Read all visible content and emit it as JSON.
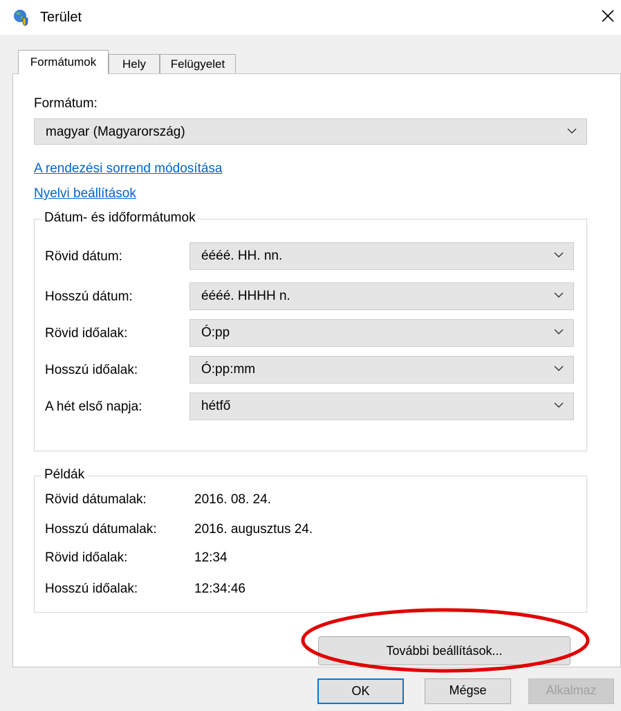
{
  "window": {
    "title": "Terület",
    "icon": "globe-shield-icon",
    "close_icon": "close-icon"
  },
  "tabs": [
    {
      "label": "Formátumok",
      "active": true
    },
    {
      "label": "Hely",
      "active": false
    },
    {
      "label": "Felügyelet",
      "active": false
    }
  ],
  "format": {
    "label": "Formátum:",
    "value": "magyar (Magyarország)"
  },
  "links": {
    "sort_order": "A rendezési sorrend módosítása",
    "language_settings": "Nyelvi beállítások"
  },
  "date_time": {
    "legend": "Dátum- és időformátumok",
    "rows": [
      {
        "label": "Rövid dátum:",
        "value": "éééé. HH. nn."
      },
      {
        "label": "Hosszú dátum:",
        "value": "éééé. HHHH n."
      },
      {
        "label": "Rövid időalak:",
        "value": "Ó:pp"
      },
      {
        "label": "Hosszú időalak:",
        "value": "Ó:pp:mm"
      },
      {
        "label": "A hét első napja:",
        "value": "hétfő"
      }
    ]
  },
  "examples": {
    "legend": "Példák",
    "rows": [
      {
        "label": "Rövid dátumalak:",
        "value": "2016. 08. 24."
      },
      {
        "label": "Hosszú dátumalak:",
        "value": "2016. augusztus 24."
      },
      {
        "label": "Rövid időalak:",
        "value": "12:34"
      },
      {
        "label": "Hosszú időalak:",
        "value": "12:34:46"
      }
    ]
  },
  "buttons": {
    "additional_settings": "További beállítások...",
    "ok": "OK",
    "cancel": "Mégse",
    "apply": "Alkalmaz"
  },
  "colors": {
    "link": "#0066cc",
    "highlight_ellipse": "#e00000",
    "primary_border": "#0078d7"
  }
}
